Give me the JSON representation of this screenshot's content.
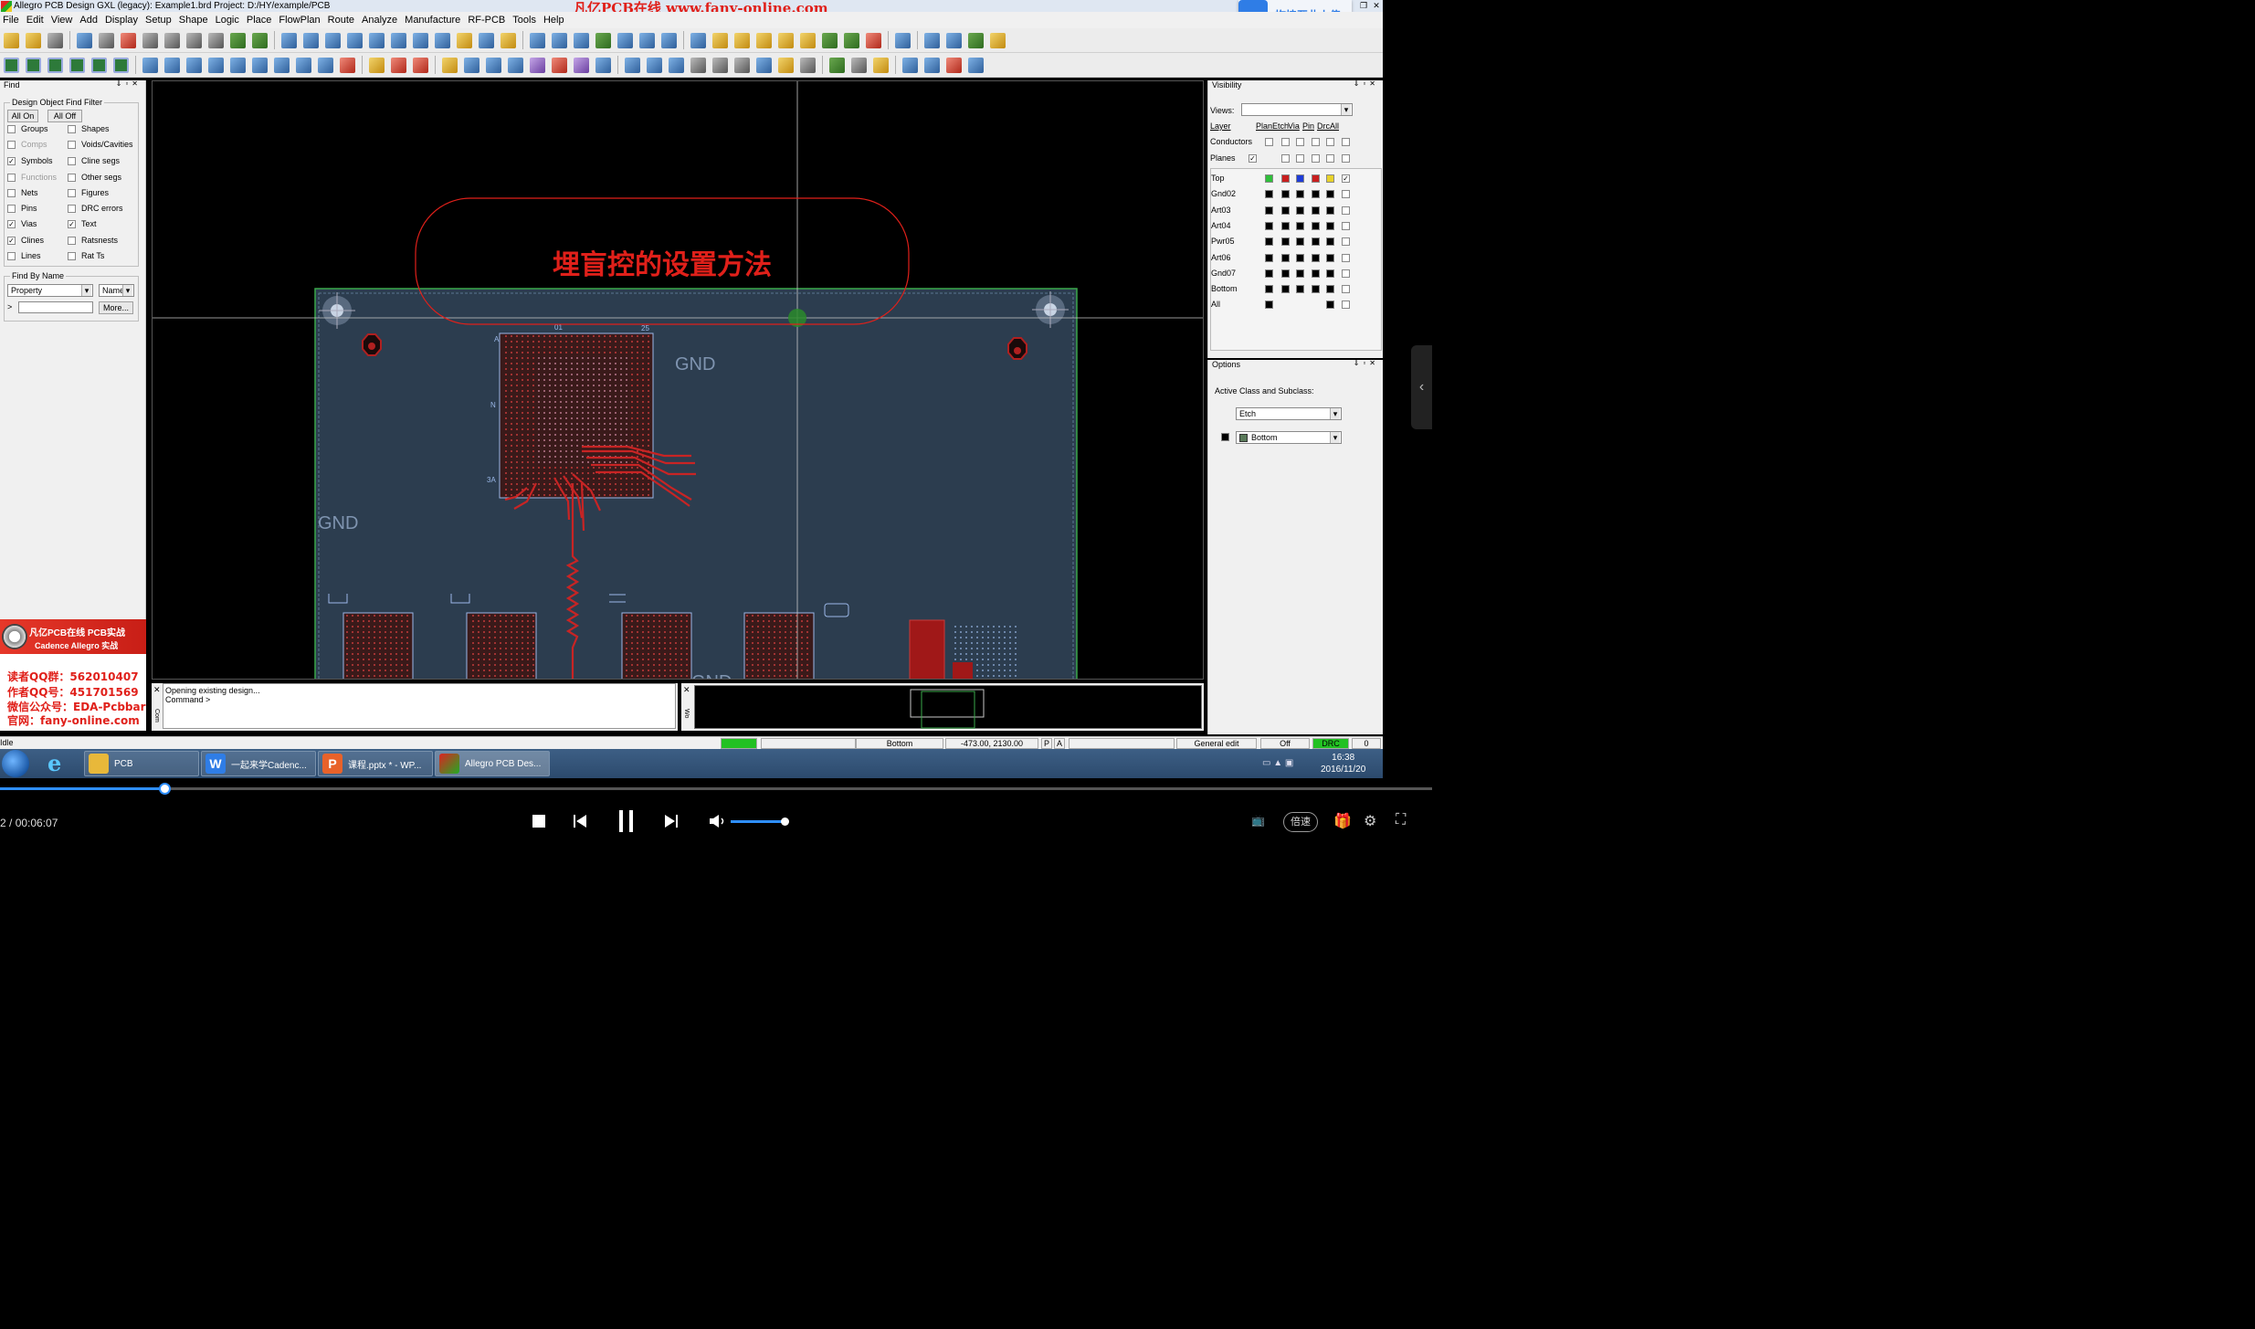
{
  "window": {
    "title": "Allegro PCB Design GXL (legacy): Example1.brd  Project: D:/HY/example/PCB",
    "watermark": "凡亿PCB在线 www.fany-online.com",
    "upload_overlay": "拖拽至此上传",
    "brand_partial": "nce"
  },
  "menu": [
    "File",
    "Edit",
    "View",
    "Add",
    "Display",
    "Setup",
    "Shape",
    "Logic",
    "Place",
    "FlowPlan",
    "Route",
    "Analyze",
    "Manufacture",
    "RF-PCB",
    "Tools",
    "Help"
  ],
  "find_panel": {
    "title": "Find",
    "filter_group": "Design Object Find Filter",
    "all_on": "All On",
    "all_off": "All Off",
    "left_items": [
      {
        "label": "Groups",
        "checked": false,
        "disabled": false
      },
      {
        "label": "Comps",
        "checked": false,
        "disabled": true
      },
      {
        "label": "Symbols",
        "checked": true,
        "disabled": false
      },
      {
        "label": "Functions",
        "checked": false,
        "disabled": true
      },
      {
        "label": "Nets",
        "checked": false,
        "disabled": false
      },
      {
        "label": "Pins",
        "checked": false,
        "disabled": false
      },
      {
        "label": "Vias",
        "checked": true,
        "disabled": false
      },
      {
        "label": "Clines",
        "checked": true,
        "disabled": false
      },
      {
        "label": "Lines",
        "checked": false,
        "disabled": false
      }
    ],
    "right_items": [
      {
        "label": "Shapes",
        "checked": false,
        "disabled": false
      },
      {
        "label": "Voids/Cavities",
        "checked": false,
        "disabled": false
      },
      {
        "label": "Cline segs",
        "checked": false,
        "disabled": false
      },
      {
        "label": "Other segs",
        "checked": false,
        "disabled": false
      },
      {
        "label": "Figures",
        "checked": false,
        "disabled": false
      },
      {
        "label": "DRC errors",
        "checked": false,
        "disabled": false
      },
      {
        "label": "Text",
        "checked": true,
        "disabled": false
      },
      {
        "label": "Ratsnests",
        "checked": false,
        "disabled": false
      },
      {
        "label": "Rat Ts",
        "checked": false,
        "disabled": false
      }
    ],
    "by_name_group": "Find By Name",
    "property_select": "Property",
    "name_select": "Name",
    "prompt": ">",
    "more_button": "More..."
  },
  "promo": {
    "line1": "凡亿PCB在线 PCB实战",
    "line2": "Cadence Allegro 实战",
    "reader_qq": "读者QQ群：562010407",
    "author_qq": "作者QQ号：451701569",
    "wechat": "微信公众号：EDA-Pcbbar",
    "site": "官网：fany-online.com"
  },
  "canvas": {
    "overlay_title": "埋盲控的设置方法",
    "gnd_label_1": "GND",
    "gnd_label_2": "GND",
    "gnd_label_3": "GND",
    "ref_a": "A",
    "ref_n": "N",
    "ref_3a": "3A",
    "ref_01": "01",
    "ref_25": "25"
  },
  "visibility": {
    "title": "Visibility",
    "views_label": "Views:",
    "col_layer": "Layer",
    "cols": [
      "Plan",
      "Etch",
      "Via",
      "Pin",
      "Drc",
      "All"
    ],
    "groups": [
      {
        "name": "Conductors",
        "plan": false
      },
      {
        "name": "Planes",
        "plan": true
      }
    ],
    "layers": [
      "Top",
      "Gnd02",
      "Art03",
      "Art04",
      "Pwr05",
      "Art06",
      "Gnd07",
      "Bottom",
      "All"
    ],
    "top_colors": [
      "#2fbf3a",
      "#c81e1e",
      "#1e3cd8",
      "#c81e1e",
      "#e8d22a"
    ]
  },
  "options": {
    "title": "Options",
    "active_label": "Active Class and Subclass:",
    "class_value": "Etch",
    "subclass_value": "Bottom"
  },
  "console": {
    "line1": "Opening existing design...",
    "line2": "Command >"
  },
  "status": {
    "mode": "Idle",
    "layer": "Bottom",
    "coords": "-473.00, 2130.00",
    "p_btn": "P",
    "a_btn": "A",
    "edit_mode": "General edit",
    "off": "Off",
    "drc": "DRC",
    "drc_count": "0"
  },
  "taskbar": {
    "tasks": [
      {
        "label": "PCB",
        "color": "#e8b83a"
      },
      {
        "label": "一起来学Cadenc...",
        "color": "#2f7de6"
      },
      {
        "label": "课程.pptx * - WP...",
        "color": "#e8622a"
      },
      {
        "label": "Allegro PCB Des...",
        "color": "#3aa83a"
      }
    ],
    "time": "16:38",
    "date": "2016/11/20"
  },
  "player": {
    "current_time": "2 /",
    "total_time": "00:06:07",
    "progress": 0.115,
    "volume": 0.9,
    "speed_label": "倍速"
  }
}
